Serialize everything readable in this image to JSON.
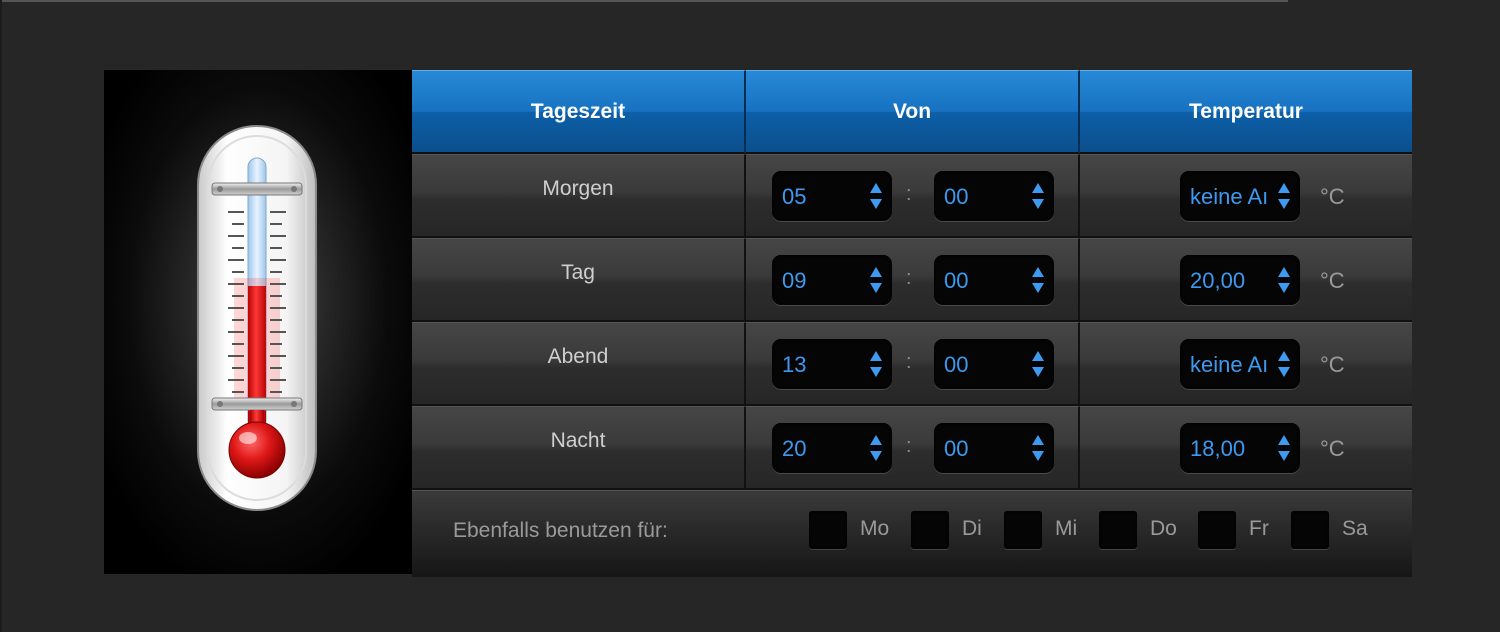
{
  "table": {
    "headers": [
      "Tageszeit",
      "Von",
      "Temperatur"
    ],
    "rows": [
      {
        "label": "Morgen",
        "hour": "05",
        "minute": "00",
        "temp": "keine Aı"
      },
      {
        "label": "Tag",
        "hour": "09",
        "minute": "00",
        "temp": "20,00"
      },
      {
        "label": "Abend",
        "hour": "13",
        "minute": "00",
        "temp": "keine Aı"
      },
      {
        "label": "Nacht",
        "hour": "20",
        "minute": "00",
        "temp": "18,00"
      }
    ],
    "separator": ":",
    "unit": "°C"
  },
  "footer": {
    "label": "Ebenfalls benutzen für:",
    "days": [
      "Mo",
      "Di",
      "Mi",
      "Do",
      "Fr",
      "Sa"
    ]
  },
  "icons": {
    "thermometer": "thermometer-icon",
    "spinner": "spinner-arrows-icon"
  },
  "colors": {
    "accent": "#3d9af0",
    "header_blue": "#1772c0",
    "mercury_red": "#e01818"
  }
}
